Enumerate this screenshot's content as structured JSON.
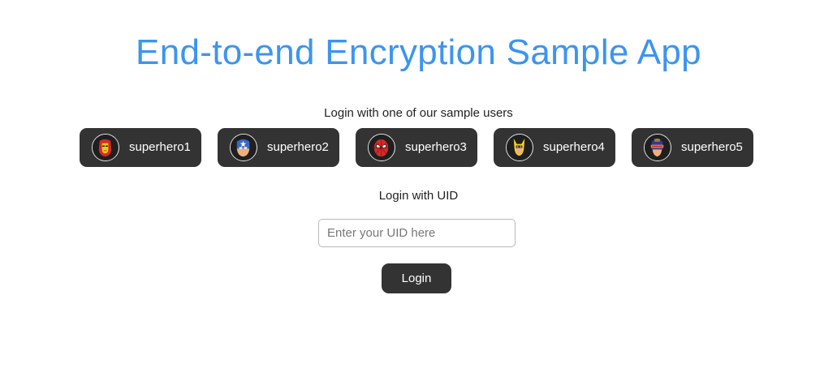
{
  "header": {
    "title": "End-to-end Encryption Sample App"
  },
  "sample_users": {
    "label": "Login with one of our sample users",
    "users": [
      {
        "name": "superhero1",
        "avatar_icon": "iron-man-icon"
      },
      {
        "name": "superhero2",
        "avatar_icon": "captain-america-icon"
      },
      {
        "name": "superhero3",
        "avatar_icon": "spider-man-icon"
      },
      {
        "name": "superhero4",
        "avatar_icon": "wolverine-icon"
      },
      {
        "name": "superhero5",
        "avatar_icon": "cyclops-icon"
      }
    ]
  },
  "uid_login": {
    "label": "Login with UID",
    "input_placeholder": "Enter your UID here",
    "input_value": "",
    "button_label": "Login"
  },
  "colors": {
    "title": "#3b95f0",
    "button_bg": "#333333",
    "button_text": "#ffffff"
  }
}
